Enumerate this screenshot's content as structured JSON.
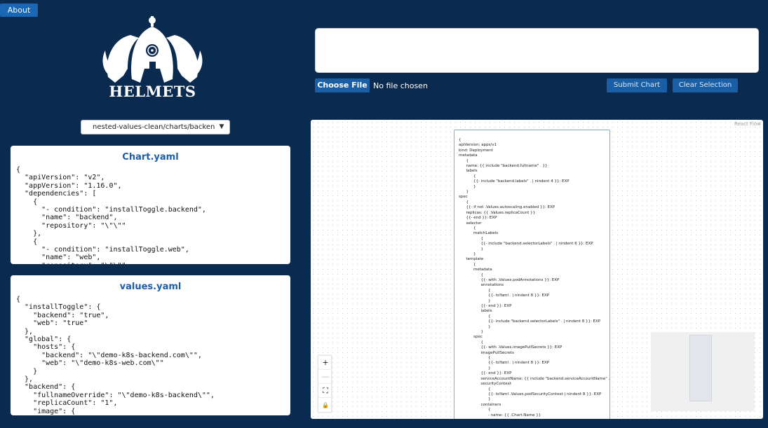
{
  "header": {
    "about_label": "About"
  },
  "logo": {
    "text": "HELMETS"
  },
  "upload": {
    "choose_file_label": "Choose File",
    "no_file_text": "No file chosen",
    "submit_label": "Submit Chart",
    "clear_label": "Clear Selection"
  },
  "template_select": {
    "selected": "nested-values-clean/charts/backend/templates/deployment.yaml"
  },
  "chart_panel": {
    "title": "Chart.yaml",
    "content": "{\n  \"apiVersion\": \"v2\",\n  \"appVersion\": \"1.16.0\",\n  \"dependencies\": [\n    {\n      \"- condition\": \"installToggle.backend\",\n      \"name\": \"backend\",\n      \"repository\": \"\\\"\\\"\"\n    },\n    {\n      \"- condition\": \"installToggle.web\",\n      \"name\": \"web\",\n      \"repository\": \"\\\"\\\"\""
  },
  "values_panel": {
    "title": "values.yaml",
    "content": "{\n  \"installToggle\": {\n    \"backend\": \"true\",\n    \"web\": \"true\"\n  },\n  \"global\": {\n    \"hosts\": {\n      \"backend\": \"\\\"demo-k8s-backend.com\\\"\",\n      \"web\": \"\\\"demo-k8s-web.com\\\"\"\n    }\n  },\n  \"backend\": {\n    \"fullnameOverride\": \"\\\"demo-k8s-backend\\\"\",\n    \"replicaCount\": \"1\",\n    \"image\": {"
  },
  "flow": {
    "attribution": "React Flow",
    "node_text": "{\napiVersion: apps/v1\nkind: Deployment\nmetadata\n      {\n      name: {{ include \"backend.fullname\" . }}\n      labels\n            {\n            {{- include \"backend.labels\" . | nindent 4 }}: EXP\n            }\n      }\nspec\n      {\n      {{- if not .Values.autoscaling.enabled }}: EXP\n      replicas: {{ .Values.replicaCount }}\n      {{- end }}: EXP\n      selector\n            {\n            matchLabels\n                  {\n                  {{- include \"backend.selectorLabels\" . | nindent 6 }}: EXP\n                  }\n            }\n      template\n            {\n            metadata\n                  {\n                  {{- with .Values.podAnnotations }}: EXP\n                  annotations\n                        {\n                        {{- toYaml . | nindent 8 }}: EXP\n                        }\n                  {{- end }}: EXP\n                  labels\n                        {\n                        {{- include \"backend.selectorLabels\" . | nindent 8 }}: EXP\n                        }\n                  }\n            spec\n                  {\n                  {{- with .Values.imagePullSecrets }}: EXP\n                  imagePullSecrets\n                        {\n                        {{- toYaml . | nindent 8 }}: EXP\n                        }\n                  {{- end }}: EXP\n                  serviceAccountName: {{ include \"backend.serviceAccountName\" . }}\n                  securityContext\n                        {\n                        {{- toYaml .Values.podSecurityContext | nindent 8 }}: EXP\n                        }\n                  containers\n                        {\n                        - name: {{ .Chart.Name }}",
    "controls": {
      "zoom_in": "+",
      "zoom_out": "—",
      "fit": "⛶",
      "lock": "🔒"
    }
  },
  "colors": {
    "background": "#0b2a4f",
    "button": "#1a5fa6",
    "title": "#1d5ea8",
    "node_border": "#7fb2c5"
  }
}
